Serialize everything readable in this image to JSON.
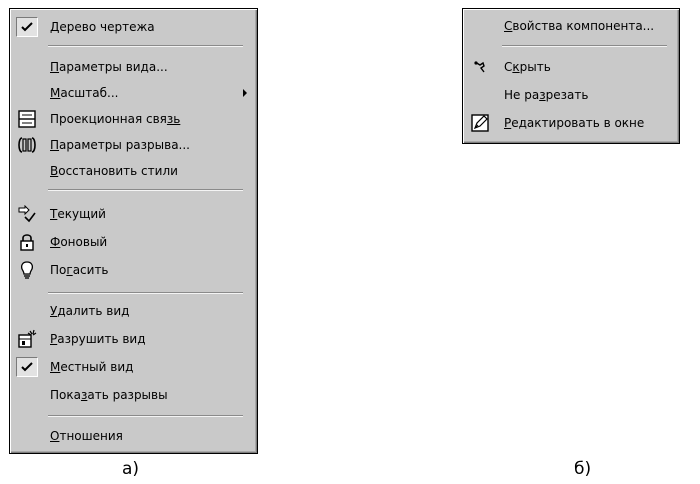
{
  "menu_a": {
    "items": [
      {
        "pre": "",
        "acc": "Д",
        "post": "ерево чертежа",
        "icon": "checkmark-icon",
        "checked": true
      },
      {
        "pre": "",
        "acc": "П",
        "post": "араметры вида...",
        "icon": ""
      },
      {
        "pre": "",
        "acc": "М",
        "post": "асштаб...",
        "icon": "",
        "submenu": true
      },
      {
        "pre": "Проекционная свя",
        "acc": "зь",
        "post": "",
        "icon": "projection-link-icon"
      },
      {
        "pre": "",
        "acc": "П",
        "post": "араметры разрыва...",
        "icon": "break-params-icon"
      },
      {
        "pre": "",
        "acc": "В",
        "post": "осстановить стили",
        "icon": ""
      },
      {
        "pre": "",
        "acc": "Т",
        "post": "екущий",
        "icon": "current-view-icon"
      },
      {
        "pre": "",
        "acc": "Ф",
        "post": "оновый",
        "icon": "padlock-icon"
      },
      {
        "pre": "По",
        "acc": "г",
        "post": "асить",
        "icon": "lightbulb-icon"
      },
      {
        "pre": "",
        "acc": "У",
        "post": "далить вид",
        "icon": ""
      },
      {
        "pre": "",
        "acc": "Р",
        "post": "азрушить вид",
        "icon": "destroy-view-icon"
      },
      {
        "pre": "",
        "acc": "М",
        "post": "естный вид",
        "icon": "checkmark-icon",
        "checked": true
      },
      {
        "pre": "Пока",
        "acc": "з",
        "post": "ать разрывы",
        "icon": ""
      },
      {
        "pre": "",
        "acc": "О",
        "post": "тношения",
        "icon": ""
      }
    ],
    "caption": "а)"
  },
  "menu_b": {
    "items": [
      {
        "pre": "",
        "acc": "С",
        "post": "войства компонента...",
        "icon": ""
      },
      {
        "pre": "С",
        "acc": "к",
        "post": "рыть",
        "icon": "hide-pin-icon"
      },
      {
        "pre": "Не ра",
        "acc": "з",
        "post": "резать",
        "icon": ""
      },
      {
        "pre": "",
        "acc": "Р",
        "post": "едактировать в окне",
        "icon": "edit-in-window-icon"
      }
    ],
    "caption": "б)"
  },
  "colors": {
    "menu_bg": "#c9c9c9",
    "text": "#000000",
    "separator": "#8a8a8a"
  }
}
